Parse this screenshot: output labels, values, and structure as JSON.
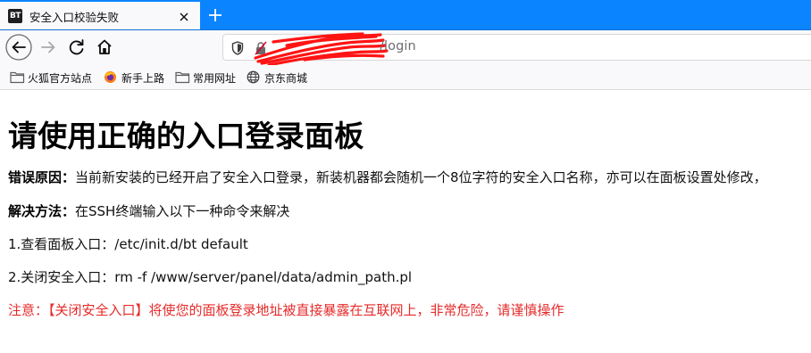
{
  "tab": {
    "favicon_text": "BT",
    "title": "安全入口校验失败"
  },
  "urlbar": {
    "url_visible": "/login"
  },
  "bookmarks": [
    {
      "icon": "folder-icon",
      "label": "火狐官方站点"
    },
    {
      "icon": "firefox-icon",
      "label": "新手上路"
    },
    {
      "icon": "folder-icon",
      "label": "常用网址"
    },
    {
      "icon": "globe-icon",
      "label": "京东商城"
    }
  ],
  "content": {
    "heading": "请使用正确的入口登录面板",
    "reason_label": "错误原因：",
    "reason_text": "当前新安装的已经开启了安全入口登录，新装机器都会随机一个8位字符的安全入口名称，亦可以在面板设置处修改，",
    "solution_label": "解决方法：",
    "solution_text": "在SSH终端输入以下一种命令来解决",
    "step1": "1.查看面板入口：/etc/init.d/bt default",
    "step2": "2.关闭安全入口：rm -f /www/server/panel/data/admin_path.pl",
    "warning": "注意：【关闭安全入口】将使您的面板登录地址被直接暴露在互联网上，非常危险，请谨慎操作"
  },
  "colors": {
    "tabbar": "#0a84ff",
    "toolbar": "#f9f9fb",
    "warning": "#e62b2b"
  }
}
